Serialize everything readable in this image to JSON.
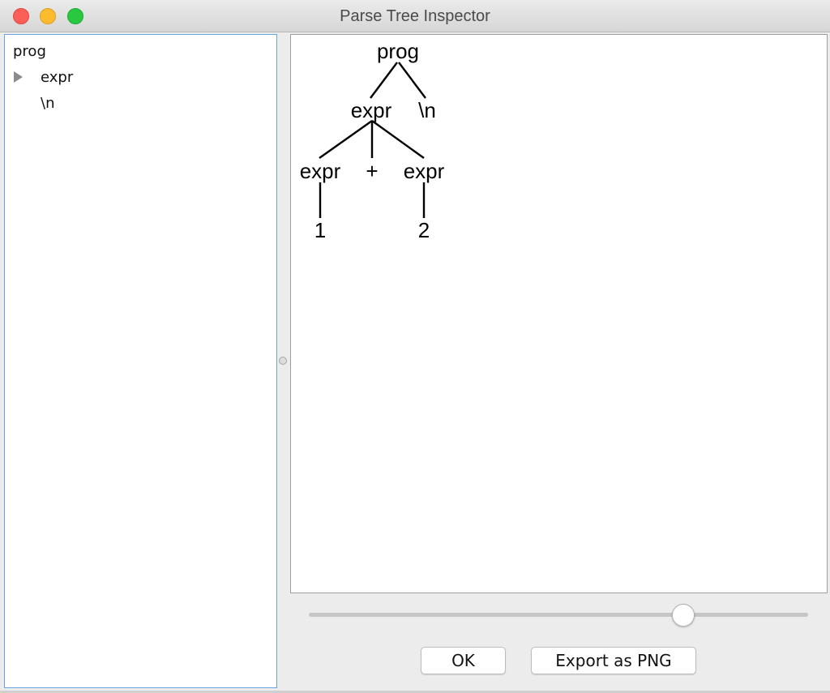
{
  "window": {
    "title": "Parse Tree Inspector"
  },
  "tree_panel": {
    "rows": [
      {
        "label": "prog",
        "expanded": true
      },
      {
        "label": "expr",
        "collapsed_disclosure": true
      },
      {
        "label": "\\n"
      }
    ]
  },
  "parse_tree": {
    "nodes": [
      {
        "id": "prog",
        "label": "prog",
        "parent": null
      },
      {
        "id": "expr_top",
        "label": "expr",
        "parent": "prog"
      },
      {
        "id": "newline",
        "label": "\\n",
        "parent": "prog"
      },
      {
        "id": "expr_left",
        "label": "expr",
        "parent": "expr_top"
      },
      {
        "id": "plus",
        "label": "+",
        "parent": "expr_top"
      },
      {
        "id": "expr_right",
        "label": "expr",
        "parent": "expr_top"
      },
      {
        "id": "one",
        "label": "1",
        "parent": "expr_left"
      },
      {
        "id": "two",
        "label": "2",
        "parent": "expr_right"
      }
    ]
  },
  "zoom_slider": {
    "value_fraction": 0.75
  },
  "buttons": {
    "ok_label": "OK",
    "export_label": "Export as PNG"
  },
  "colors": {
    "close": "#fc5f57",
    "minimize": "#fdbc2e",
    "maximize": "#28c840",
    "selection_border": "#6aa4e0"
  }
}
